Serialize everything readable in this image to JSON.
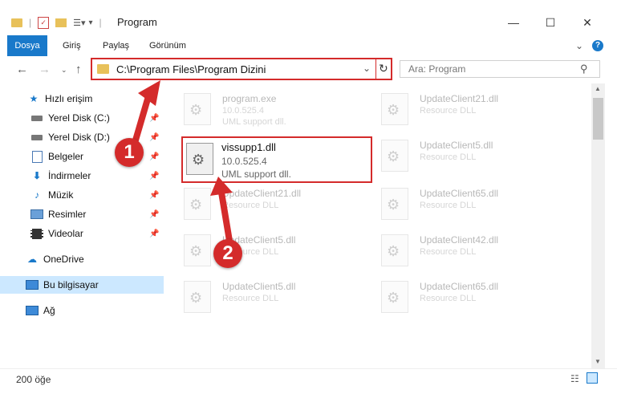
{
  "window": {
    "title": "Program"
  },
  "ribbon": {
    "tabs": [
      "Dosya",
      "Giriş",
      "Paylaş",
      "Görünüm"
    ]
  },
  "address": {
    "path": "C:\\Program Files\\Program Dizini"
  },
  "search": {
    "placeholder": "Ara: Program"
  },
  "sidebar": {
    "items": [
      {
        "label": "Hızlı erişim",
        "icon": "star-icon"
      },
      {
        "label": "Yerel Disk (C:)",
        "icon": "drive-icon"
      },
      {
        "label": "Yerel Disk (D:)",
        "icon": "drive-icon"
      },
      {
        "label": "Belgeler",
        "icon": "document-icon"
      },
      {
        "label": "İndirmeler",
        "icon": "download-icon"
      },
      {
        "label": "Müzik",
        "icon": "music-icon"
      },
      {
        "label": "Resimler",
        "icon": "picture-icon"
      },
      {
        "label": "Videolar",
        "icon": "video-icon"
      },
      {
        "label": "OneDrive",
        "icon": "cloud-icon"
      },
      {
        "label": "Bu bilgisayar",
        "icon": "computer-icon"
      },
      {
        "label": "Ağ",
        "icon": "network-icon"
      }
    ]
  },
  "files": [
    {
      "name": "program.exe",
      "line2": "10.0.525.4",
      "line3": "UML support dll."
    },
    {
      "name": "UpdateClient21.dll",
      "line2": "Resource DLL",
      "line3": ""
    },
    {
      "name": "UpdateClient5.dll",
      "line2": "Resource DLL",
      "line3": ""
    },
    {
      "name": "UpdateClient21.dll",
      "line2": "Resource DLL",
      "line3": ""
    },
    {
      "name": "UpdateClient65.dll",
      "line2": "Resource DLL",
      "line3": ""
    },
    {
      "name": "UpdateClient5.dll",
      "line2": "Resource DLL",
      "line3": ""
    },
    {
      "name": "UpdateClient42.dll",
      "line2": "Resource DLL",
      "line3": ""
    },
    {
      "name": "UpdateClient5.dll",
      "line2": "Resource DLL",
      "line3": ""
    },
    {
      "name": "UpdateClient65.dll",
      "line2": "Resource DLL",
      "line3": ""
    }
  ],
  "highlighted_file": {
    "name": "vissupp1.dll",
    "line2": "10.0.525.4",
    "line3": "UML support dll."
  },
  "status": {
    "count": "200 öğe"
  },
  "annotations": {
    "step1": "1",
    "step2": "2"
  },
  "colors": {
    "accent": "#1979ca",
    "highlight": "#d42b2b",
    "selected": "#cce8ff"
  }
}
